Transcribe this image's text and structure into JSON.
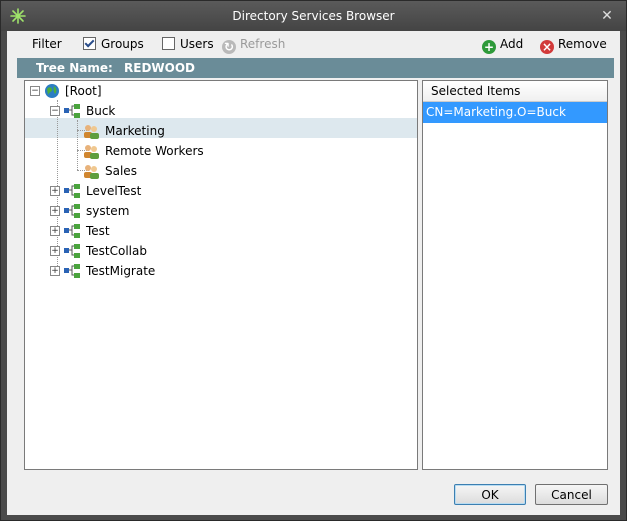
{
  "window": {
    "title": "Directory Services Browser"
  },
  "toolbar": {
    "filter_label": "Filter",
    "groups_label": "Groups",
    "groups_checked": true,
    "users_label": "Users",
    "users_checked": false,
    "refresh_label": "Refresh",
    "add_label": "Add",
    "remove_label": "Remove"
  },
  "tree_name": {
    "label": "Tree Name:",
    "value": "REDWOOD"
  },
  "tree": {
    "root": "[Root]",
    "buck": "Buck",
    "buck_children": [
      "Marketing",
      "Remote Workers",
      "Sales"
    ],
    "siblings": [
      "LevelTest",
      "system",
      "Test",
      "TestCollab",
      "TestMigrate"
    ]
  },
  "selected": {
    "header": "Selected Items",
    "items": [
      "CN=Marketing.O=Buck"
    ]
  },
  "buttons": {
    "ok": "OK",
    "cancel": "Cancel"
  },
  "colors": {
    "accent": "#3399ff",
    "treename_bar": "#6a8c98",
    "add_green": "#2e9a3a",
    "remove_red": "#d23a3a"
  }
}
